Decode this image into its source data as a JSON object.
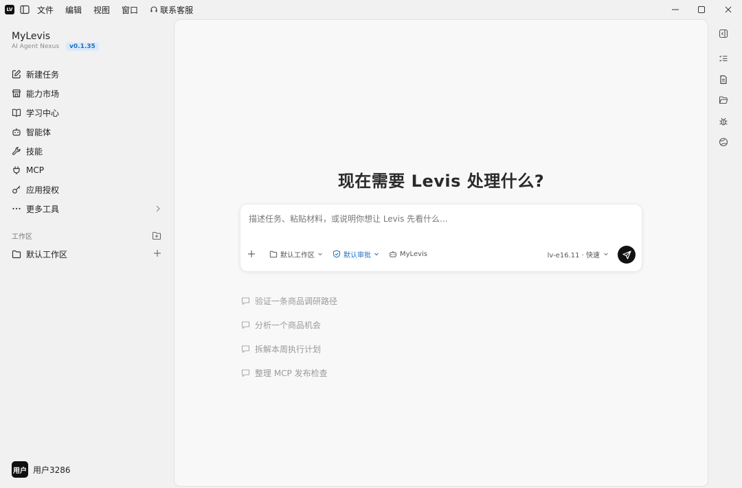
{
  "titlebar": {
    "logo_text": "LV",
    "menu": [
      "文件",
      "编辑",
      "视图",
      "窗口"
    ],
    "support_label": "联系客服"
  },
  "sidebar": {
    "brand_name": "MyLevis",
    "brand_tagline": "AI Agent Nexus",
    "version": "v0.1.35",
    "nav": [
      {
        "label": "新建任务",
        "icon": "edit-icon"
      },
      {
        "label": "能力市场",
        "icon": "store-icon"
      },
      {
        "label": "学习中心",
        "icon": "book-icon"
      },
      {
        "label": "智能体",
        "icon": "bot-icon"
      },
      {
        "label": "技能",
        "icon": "wrench-icon"
      },
      {
        "label": "MCP",
        "icon": "plug-icon"
      },
      {
        "label": "应用授权",
        "icon": "key-icon"
      },
      {
        "label": "更多工具",
        "icon": "more-icon"
      }
    ],
    "workspace_section_title": "工作区",
    "workspace_item": "默认工作区"
  },
  "user": {
    "avatar_text": "用户",
    "name": "用户3286"
  },
  "main": {
    "headline": "现在需要 Levis 处理什么?",
    "composer": {
      "placeholder": "描述任务、粘贴材料，或说明你想让 Levis 先看什么...",
      "workspace": "默认工作区",
      "approval": "默认审批",
      "agent": "MyLevis",
      "model": "lv-e16.11 · 快速"
    },
    "suggestions": [
      "验证一条商品调研路径",
      "分析一个商品机会",
      "拆解本周执行计划",
      "整理 MCP 发布检查"
    ]
  },
  "colors": {
    "accent": "#1f6fbf",
    "send_button": "#111111",
    "version_badge_bg": "#dbe9f8"
  }
}
